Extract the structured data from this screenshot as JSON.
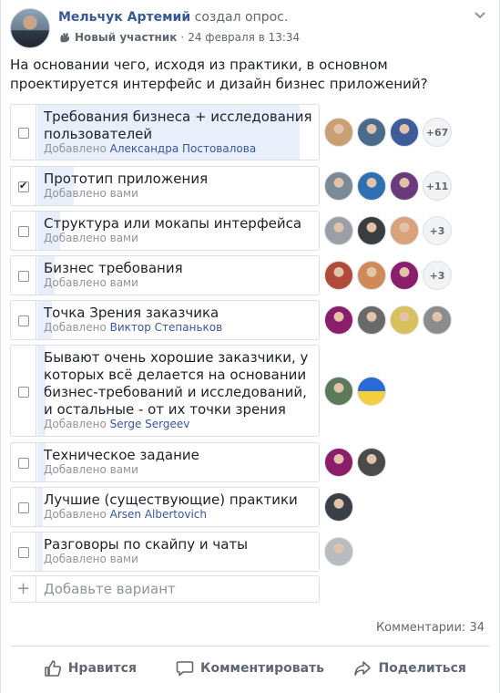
{
  "post": {
    "author": "Мельчук Артемий",
    "action": "создал опрос.",
    "badge": "Новый участник",
    "date": "24 февраля в 13:34",
    "question": "На основании чего, исходя из практики, в основном проектируется интерфейс и дизайн бизнес приложений?"
  },
  "options": [
    {
      "label": "Требования бизнеса + исследования пользователей",
      "added_prefix": "Добавлено",
      "added_by": "Александра Постовалова",
      "checked": false,
      "fill": 0.93,
      "more": "+67",
      "voters": [
        "#c9a074",
        "#4a6a8c",
        "#3c5d9a"
      ]
    },
    {
      "label": "Прототип приложения",
      "added_prefix": "Добавлено",
      "added_by_text": "вами",
      "checked": true,
      "fill": 0.13,
      "more": "+11",
      "voters": [
        "#7b8a99",
        "#2f6fb3",
        "#6b3a7a"
      ]
    },
    {
      "label": "Структура или мокапы интерфейса",
      "added_prefix": "Добавлено",
      "added_by_text": "вами",
      "checked": false,
      "fill": 0.08,
      "more": "+3",
      "voters": [
        "#9aa0a6",
        "#3a3d40",
        "#d9a27a"
      ]
    },
    {
      "label": "Бизнес требования",
      "added_prefix": "Добавлено",
      "added_by_text": "вами",
      "checked": false,
      "fill": 0.06,
      "more": "+3",
      "voters": [
        "#b04a3a",
        "#d08a5a",
        "#8a1e6a"
      ]
    },
    {
      "label": "Точка Зрения заказчика",
      "added_prefix": "Добавлено",
      "added_by": "Виктор Степаньков",
      "checked": false,
      "fill": 0.05,
      "more": "",
      "voters": [
        "#8a1e6a",
        "#6a6a6a",
        "#d8c05a",
        "#8c8c8c"
      ]
    },
    {
      "label": "Бывают очень хорошие заказчики, у которых всё делается на основании бизнес-требований и исследований, и остальные - от их точки зрения",
      "added_prefix": "Добавлено",
      "added_by": "Serge Sergeev",
      "checked": false,
      "fill": 0.03,
      "more": "",
      "voters": [
        "#5a7a5a",
        "flag"
      ]
    },
    {
      "label": "Техническое задание",
      "added_prefix": "Добавлено",
      "added_by_text": "вами",
      "checked": false,
      "fill": 0.03,
      "more": "",
      "voters": [
        "#8a1e6a",
        "#4a4a4a"
      ]
    },
    {
      "label": "Лучшие (существующие) практики",
      "added_prefix": "Добавлено",
      "added_by": "Arsen Albertovich",
      "checked": false,
      "fill": 0.02,
      "more": "",
      "voters": [
        "#3a4048"
      ]
    },
    {
      "label": "Разговоры по скайпу и чаты",
      "added_prefix": "Добавлено",
      "added_by_text": "вами",
      "checked": false,
      "fill": 0.02,
      "more": "",
      "voters": [
        "#b8bcc0"
      ]
    }
  ],
  "add_option": {
    "placeholder": "Добавьте вариант"
  },
  "comments": "Комментарии: 34",
  "actions": {
    "like": "Нравится",
    "comment": "Комментировать",
    "share": "Поделиться"
  }
}
